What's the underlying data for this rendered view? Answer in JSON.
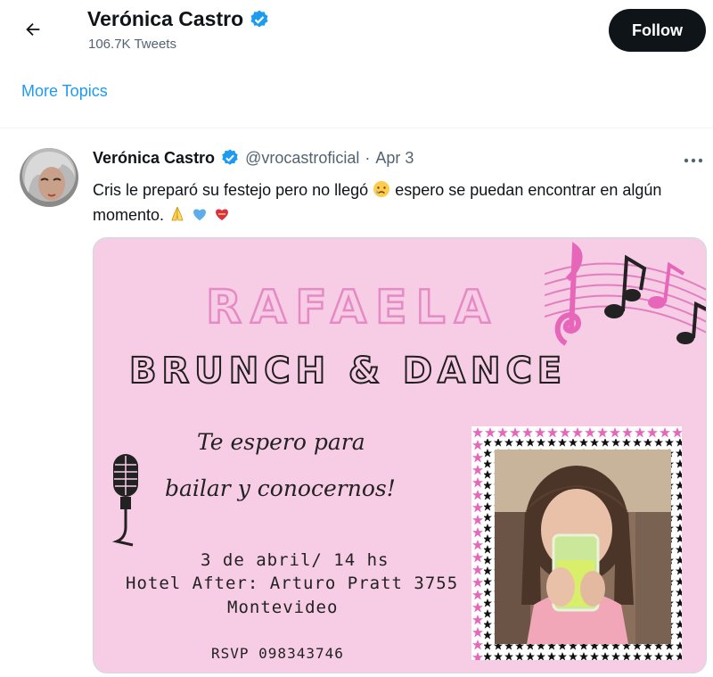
{
  "header": {
    "name": "Verónica Castro",
    "subtitle": "106.7K Tweets",
    "follow_label": "Follow",
    "back_icon": "arrow-left-icon",
    "verified_icon": "verified-badge-icon"
  },
  "topics": {
    "more_label": "More Topics"
  },
  "tweet": {
    "author_name": "Verónica Castro",
    "handle": "@vrocastroficial",
    "separator": "·",
    "date": "Apr 3",
    "text_part1": "Cris le preparó su festejo pero no llegó",
    "text_part2": "espero se puedan encontrar en algún momento.",
    "emojis": [
      "crying-face",
      "folded-hands",
      "blue-heart",
      "heart-with-ribbon"
    ],
    "more_icon": "more-horizontal-icon"
  },
  "media": {
    "title": "RAFAELA",
    "subtitle": "BRUNCH & DANCE",
    "script_line1": "Te espero para",
    "script_line2": "bailar y conocernos!",
    "date_line": "3 de abril/ 14 hs",
    "address_line": "Hotel After: Arturo Pratt 3755",
    "city_line": "Montevideo",
    "rsvp_line": "RSVP 098343746",
    "background_color": "#f7cde6"
  },
  "colors": {
    "accent": "#1d9bf0",
    "text": "#0f1419",
    "muted": "#536471",
    "button_bg": "#0f1419"
  }
}
